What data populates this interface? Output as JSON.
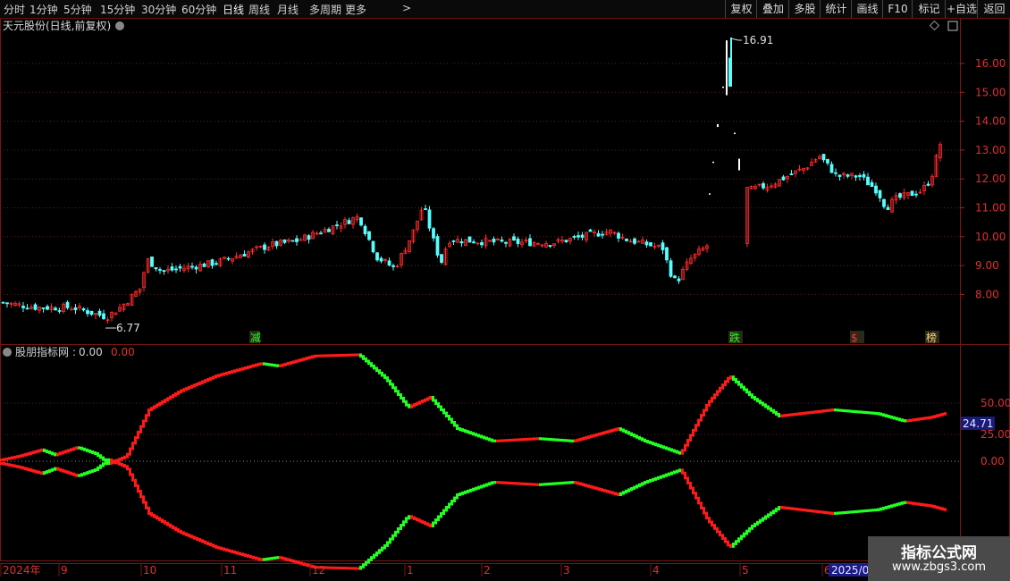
{
  "toolbar": {
    "periods": [
      "分时",
      "1分钟",
      "5分钟",
      "15分钟",
      "30分钟",
      "60分钟",
      "日线",
      "周线",
      "月线",
      "多周期",
      "更多"
    ],
    "active_period": "日线",
    "more_arrow": ">",
    "right_buttons": [
      "复权",
      "叠加",
      "多股",
      "统计",
      "画线",
      "F10",
      "标记",
      "+自选",
      "返回"
    ]
  },
  "main_chart": {
    "title": "天元股份(日线,前复权)",
    "price_labels": [
      "16.00",
      "15.00",
      "14.00",
      "13.00",
      "12.00",
      "11.00",
      "10.00",
      "9.00",
      "8.00"
    ],
    "high_label": "16.91",
    "low_label": "6.77",
    "markers": [
      {
        "text": "减",
        "color": "#20ff20"
      },
      {
        "text": "跌",
        "color": "#20ff20"
      },
      {
        "text": "$",
        "color": "#ff3030"
      },
      {
        "text": "榜",
        "color": "#ffd070"
      }
    ],
    "colors": {
      "up": "#ff2a2a",
      "down": "#54ffff"
    }
  },
  "indicator": {
    "name": "股朋指标网",
    "value1": "0.00",
    "value2": "0.00",
    "current_badge": "24.71",
    "axis_labels": [
      "50.00",
      "25.00",
      "0.00"
    ],
    "colors": {
      "up": "#ff1a1a",
      "down": "#22ff22"
    }
  },
  "time_axis": [
    "2024年",
    "9",
    "10",
    "11",
    "12",
    "1",
    "2",
    "3",
    "4",
    "5",
    "6",
    "2025/06"
  ],
  "watermark": {
    "title": "指标公式网",
    "url": "www.zbgs3.com"
  }
}
